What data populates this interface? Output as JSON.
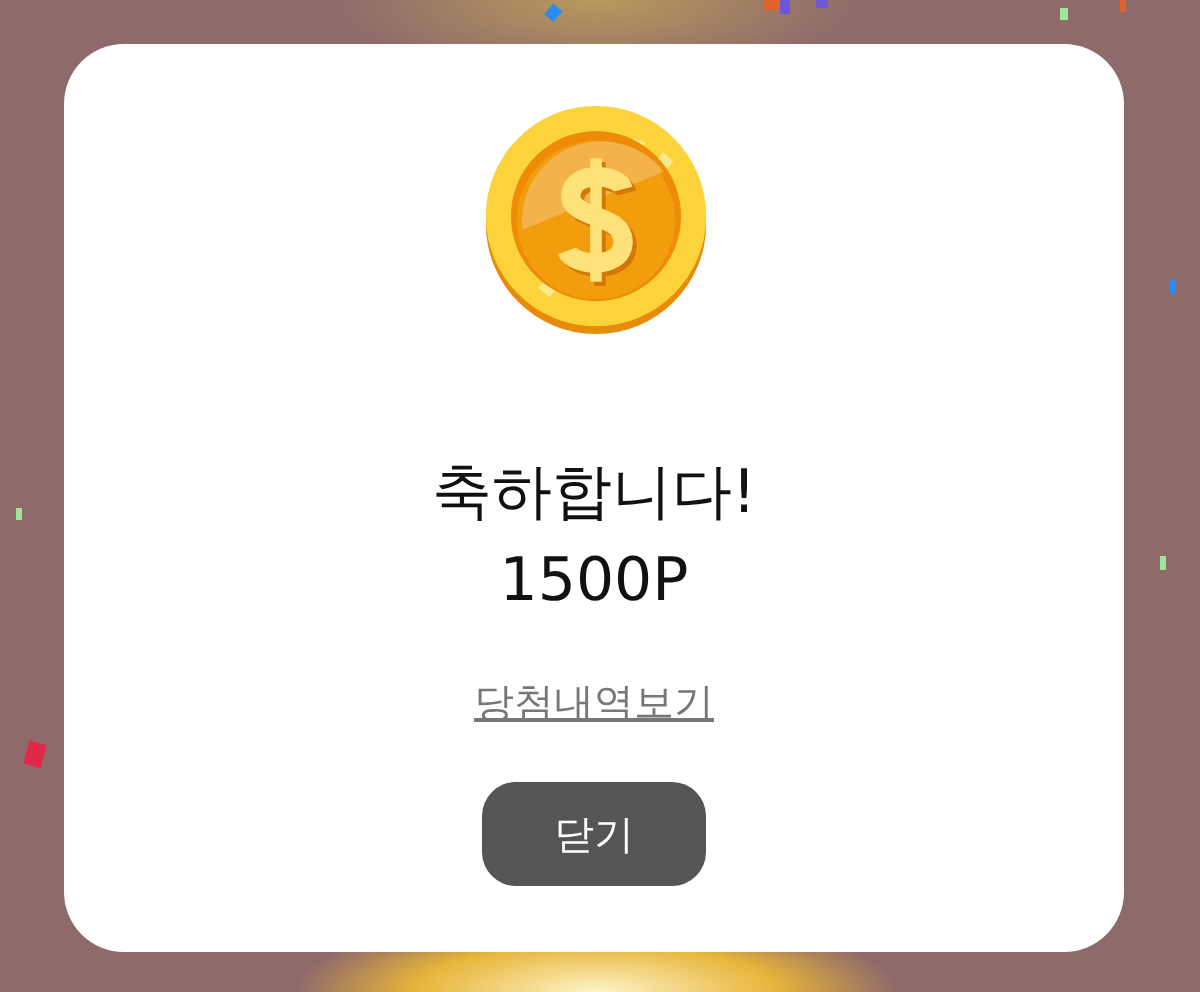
{
  "dialog": {
    "title": "축하합니다!",
    "amount": "1500P",
    "link": "당첨내역보기",
    "button": "닫기"
  }
}
